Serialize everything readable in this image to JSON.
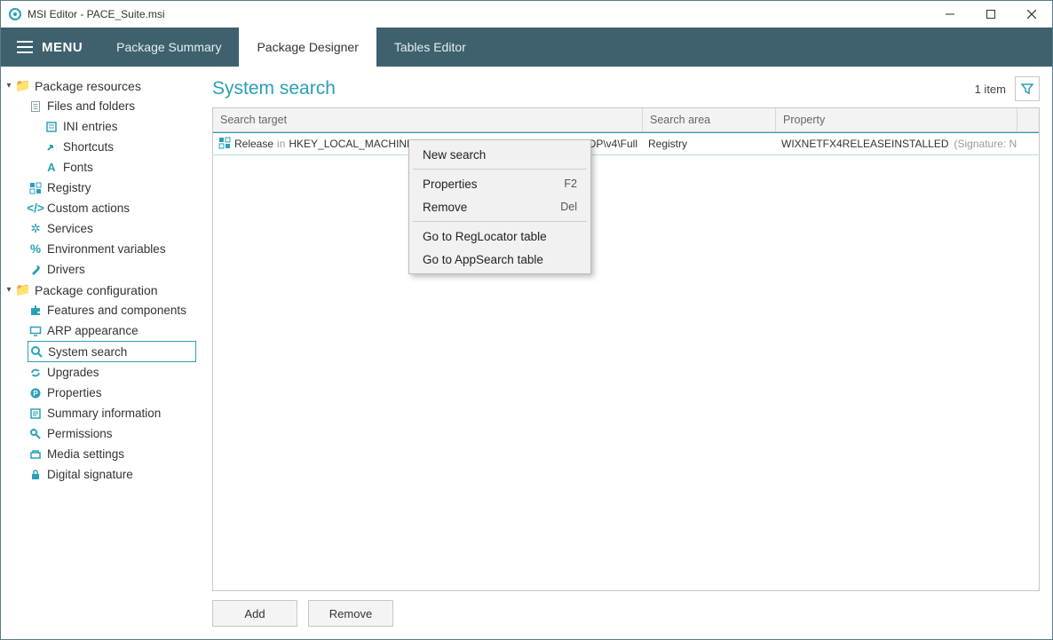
{
  "titlebar": {
    "title": "MSI Editor - PACE_Suite.msi"
  },
  "menubar": {
    "menu_label": "MENU",
    "tabs": [
      {
        "label": "Package Summary",
        "active": false
      },
      {
        "label": "Package Designer",
        "active": true
      },
      {
        "label": "Tables Editor",
        "active": false
      }
    ]
  },
  "sidebar": {
    "groups": [
      {
        "label": "Package resources",
        "items": [
          {
            "label": "Files and folders",
            "icon": "doc",
            "children": [
              {
                "label": "INI entries",
                "icon": "ini"
              },
              {
                "label": "Shortcuts",
                "icon": "shortcut"
              },
              {
                "label": "Fonts",
                "icon": "font"
              }
            ]
          },
          {
            "label": "Registry",
            "icon": "registry"
          },
          {
            "label": "Custom actions",
            "icon": "code"
          },
          {
            "label": "Services",
            "icon": "gear"
          },
          {
            "label": "Environment variables",
            "icon": "env"
          },
          {
            "label": "Drivers",
            "icon": "wrench"
          }
        ]
      },
      {
        "label": "Package configuration",
        "items": [
          {
            "label": "Features and components",
            "icon": "puzzle"
          },
          {
            "label": "ARP appearance",
            "icon": "monitor"
          },
          {
            "label": "System search",
            "icon": "search",
            "selected": true
          },
          {
            "label": "Upgrades",
            "icon": "sync"
          },
          {
            "label": "Properties",
            "icon": "prop"
          },
          {
            "label": "Summary information",
            "icon": "summary"
          },
          {
            "label": "Permissions",
            "icon": "key"
          },
          {
            "label": "Media settings",
            "icon": "media"
          },
          {
            "label": "Digital signature",
            "icon": "lock"
          }
        ]
      }
    ]
  },
  "page": {
    "title": "System search",
    "item_count": "1 item"
  },
  "grid": {
    "columns": [
      "Search target",
      "Search area",
      "Property"
    ],
    "rows": [
      {
        "target_name": "Release",
        "target_in": "in",
        "target_path": "HKEY_LOCAL_MACHINE\\SOFTWARE\\Microsoft\\NET Framework Setup\\NDP\\v4\\Full",
        "target_path_middle_visible_left": "HKEY_LOCAL_MACHINE\\SOF",
        "target_path_middle_visible_right": "NDP\\v4\\Full",
        "area": "Registry",
        "prop_name": "WIXNETFX4RELEASEINSTALLED",
        "prop_sig": "(Signature: NetFx"
      }
    ]
  },
  "buttons": {
    "add": "Add",
    "remove": "Remove"
  },
  "context_menu": {
    "items": [
      {
        "label": "New search"
      },
      {
        "sep": true
      },
      {
        "label": "Properties",
        "shortcut": "F2"
      },
      {
        "label": "Remove",
        "shortcut": "Del"
      },
      {
        "sep": true
      },
      {
        "label": "Go to RegLocator table"
      },
      {
        "label": "Go to AppSearch table"
      }
    ]
  }
}
